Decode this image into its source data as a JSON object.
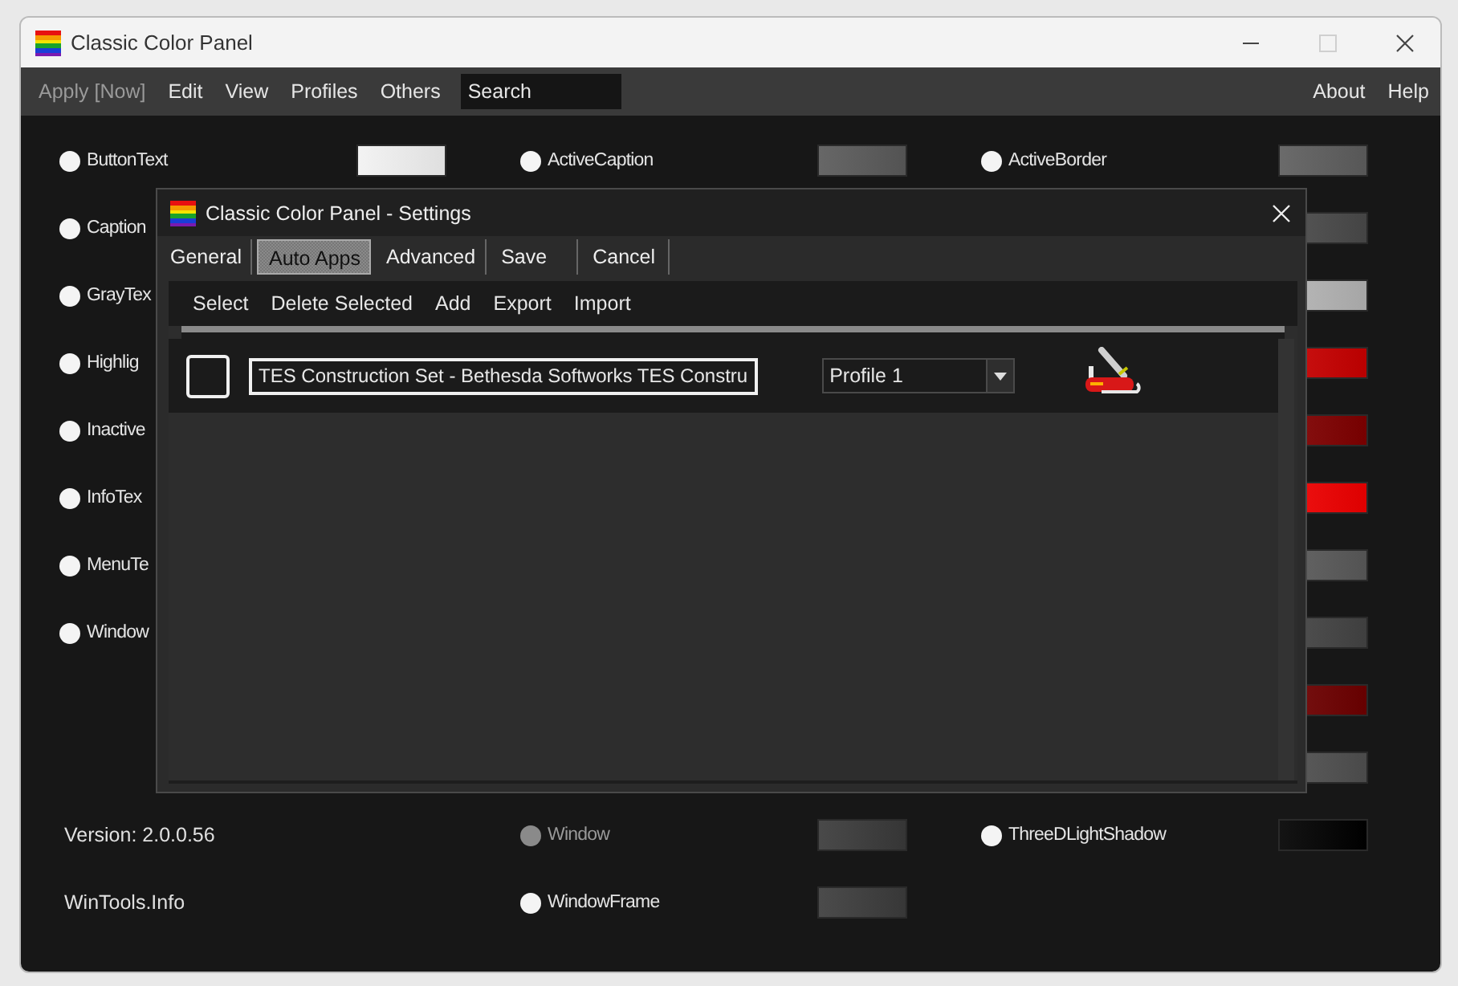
{
  "window": {
    "title": "Classic Color Panel",
    "maximize_disabled": true
  },
  "menu": {
    "left": [
      {
        "label": "Apply [Now]",
        "disabled": true
      },
      {
        "label": "Edit",
        "disabled": false
      },
      {
        "label": "View",
        "disabled": false
      },
      {
        "label": "Profiles",
        "disabled": false
      },
      {
        "label": "Others",
        "disabled": false
      }
    ],
    "search": {
      "placeholder": "Search"
    },
    "right": [
      {
        "label": "About",
        "disabled": false
      },
      {
        "label": "Help",
        "disabled": false
      }
    ]
  },
  "rows": [
    {
      "cells": [
        {
          "kind": "color",
          "label": "ButtonText",
          "color": "#f2f2f2",
          "selected": false,
          "disabled": false
        },
        {
          "kind": "color",
          "label": "ActiveCaption",
          "color": "#5a5a5a",
          "selected": false,
          "disabled": false
        },
        {
          "kind": "color",
          "label": "ActiveBorder",
          "color": "#5e5e5e",
          "selected": false,
          "disabled": false
        }
      ]
    },
    {
      "cells": [
        {
          "kind": "color",
          "label": "Caption",
          "selected": false,
          "disabled": false
        },
        {
          "kind": "blank"
        },
        {
          "kind": "color",
          "color": "#4a4a4a"
        }
      ]
    },
    {
      "cells": [
        {
          "kind": "color",
          "label": "GrayTex",
          "selected": false,
          "disabled": false
        },
        {
          "kind": "blank"
        },
        {
          "kind": "color",
          "color": "#b4b4b4"
        }
      ]
    },
    {
      "cells": [
        {
          "kind": "color",
          "label": "Highlig",
          "selected": false,
          "disabled": false
        },
        {
          "kind": "blank"
        },
        {
          "kind": "color",
          "color": "#c80000"
        }
      ]
    },
    {
      "cells": [
        {
          "kind": "color",
          "label": "Inactive",
          "selected": false,
          "disabled": false
        },
        {
          "kind": "blank"
        },
        {
          "kind": "color",
          "color": "#800000"
        }
      ]
    },
    {
      "cells": [
        {
          "kind": "color",
          "label": "InfoTex",
          "selected": false,
          "disabled": false
        },
        {
          "kind": "blank"
        },
        {
          "kind": "color",
          "color": "#f00000"
        }
      ]
    },
    {
      "cells": [
        {
          "kind": "color",
          "label": "MenuTe",
          "selected": false,
          "disabled": false
        },
        {
          "kind": "blank"
        },
        {
          "kind": "color",
          "color": "#5a5a5a"
        }
      ]
    },
    {
      "cells": [
        {
          "kind": "color",
          "label": "Window",
          "selected": false,
          "disabled": false
        },
        {
          "kind": "blank"
        },
        {
          "kind": "color",
          "color": "#444444"
        }
      ]
    },
    {
      "cells": [
        {
          "kind": "blank"
        },
        {
          "kind": "blank"
        },
        {
          "kind": "color",
          "color": "#6e0000"
        }
      ]
    },
    {
      "cells": [
        {
          "kind": "blank"
        },
        {
          "kind": "blank"
        },
        {
          "kind": "color",
          "color": "#505050"
        }
      ]
    },
    {
      "cells": [
        {
          "kind": "text",
          "label": "Version: 2.0.0.56"
        },
        {
          "kind": "color",
          "label": "Window",
          "color": "#3a3a3a",
          "selected": false,
          "disabled": true
        },
        {
          "kind": "color",
          "label": "ThreeDLightShadow",
          "color": "#000000",
          "selected": false,
          "disabled": false
        }
      ]
    },
    {
      "cells": [
        {
          "kind": "text",
          "label": "WinTools.Info"
        },
        {
          "kind": "color",
          "label": "WindowFrame",
          "color": "#3c3c3c",
          "selected": false,
          "disabled": false
        },
        {
          "kind": "blank"
        }
      ]
    }
  ],
  "dialog": {
    "title": "Classic Color Panel - Settings",
    "tabs": [
      {
        "label": "General",
        "selected": false
      },
      {
        "label": "Auto Apps",
        "selected": true
      },
      {
        "label": "Advanced",
        "selected": false
      },
      {
        "label": "Save",
        "selected": false
      },
      {
        "label": "Cancel",
        "selected": false
      }
    ],
    "toolbar": [
      "Select",
      "Delete Selected",
      "Add",
      "Export",
      "Import"
    ],
    "apps": [
      {
        "checked": false,
        "name": "TES Construction Set - Bethesda Softworks TES Constru",
        "profile": "Profile 1"
      }
    ]
  }
}
